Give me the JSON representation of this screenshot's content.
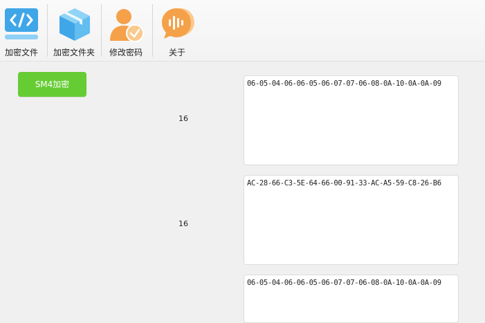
{
  "toolbar": {
    "encrypt_file": "加密文件",
    "encrypt_folder": "加密文件夹",
    "change_password": "修改密码",
    "about": "关于"
  },
  "main": {
    "sm4_button": "SM4加密",
    "key_length": "16",
    "key_hex": "06-05-04-06-06-05-06-07-07-06-08-0A-10-0A-0A-09",
    "iv_length": "16",
    "iv_hex": "AC-28-66-C3-5E-64-66-00-91-33-AC-A5-59-C8-26-B6",
    "output_hex": "06-05-04-06-06-05-06-07-07-06-08-0A-10-0A-0A-09"
  },
  "colors": {
    "button_green": "#66cc33",
    "icon_blue": "#3fa6e8",
    "icon_orange": "#f5a14a"
  },
  "icons": [
    "code-icon",
    "box-icon",
    "user-check-icon",
    "chat-bubble-icon"
  ]
}
